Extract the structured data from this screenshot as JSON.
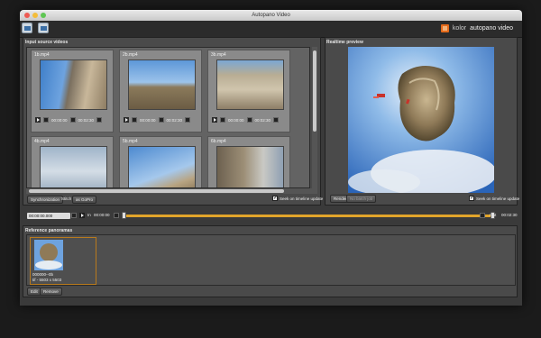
{
  "window": {
    "title": "Autopano Video"
  },
  "brand": {
    "kolor": "kolor",
    "product": "autopano video"
  },
  "input_panel": {
    "title": "Input source videos",
    "tiles": [
      {
        "name": "1b.mp4",
        "time_start": "00:00:00",
        "time_end": "00:02:30"
      },
      {
        "name": "2b.mp4",
        "time_start": "00:00:00",
        "time_end": "00:02:30"
      },
      {
        "name": "3b.mp4",
        "time_start": "00:00:00",
        "time_end": "00:02:30"
      },
      {
        "name": "4b.mp4",
        "time_start": "",
        "time_end": ""
      },
      {
        "name": "5b.mp4",
        "time_start": "",
        "time_end": ""
      },
      {
        "name": "6b.mp4",
        "time_start": "",
        "time_end": ""
      }
    ],
    "sync_button": "Synchronization",
    "stitch_label": "Stitch",
    "stitch_value": "as GoPro",
    "seek_label": "Seek on timeline update"
  },
  "preview_panel": {
    "title": "Realtime preview",
    "render_button": "Render",
    "batch_button": "No batch job",
    "seek_label": "Seek on timeline update"
  },
  "timeline": {
    "start": "00:00:00.000",
    "in_label": "In",
    "in_time": "00:00:00",
    "out_label": "Out",
    "out_time": "00:02:30"
  },
  "reference": {
    "title": "Reference panoramas",
    "item_name": "000000--0b",
    "item_size": "tif - 5503 x 5503",
    "edit_button": "Edit",
    "remove_button": "Remove"
  }
}
